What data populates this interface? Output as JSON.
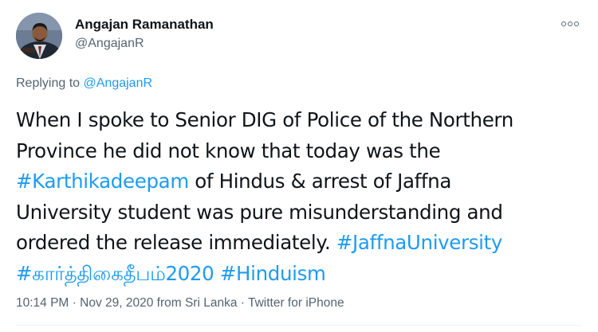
{
  "author": {
    "name": "Angajan Ramanathan",
    "handle": "@AngajanR",
    "avatar_icon": "profile-photo"
  },
  "more_icon": "more-options-icon",
  "reply": {
    "prefix": "Replying to ",
    "handle": "@AngajanR"
  },
  "body": {
    "line1": "When I spoke to Senior DIG of Police of the Northern",
    "line2": "Province he did not know that today was the",
    "line3_hashtag": "#Karthikadeepam",
    "line3_text": " of Hindus & arrest of Jaffna",
    "line4": "University student was pure misunderstanding and",
    "line5_text": "ordered the release immediately. ",
    "line5_hashtag": "#JaffnaUniversity",
    "line6_hashtag1": "#கார்த்திகைதீபம்2020",
    "line6_sep": " ",
    "line6_hashtag2": "#Hinduism"
  },
  "meta": {
    "time": "10:14 PM",
    "dot1": " · ",
    "date": "Nov 29, 2020",
    "location": " from Sri Lanka",
    "dot2": " · ",
    "client": "Twitter for iPhone"
  },
  "colors": {
    "link": "#1d9bf0",
    "text": "#0f1419",
    "secondary": "#536471"
  }
}
